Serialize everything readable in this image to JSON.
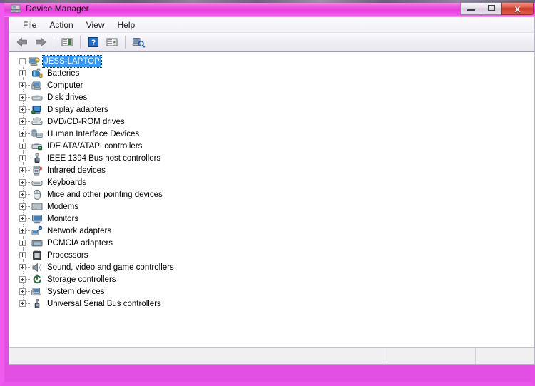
{
  "window": {
    "title": "Device Manager",
    "title_icon": "device-manager-icon",
    "buttons": {
      "minimize": "–",
      "maximize": "□",
      "close": "x"
    }
  },
  "menubar": {
    "items": [
      {
        "label": "File",
        "name": "menu-file"
      },
      {
        "label": "Action",
        "name": "menu-action"
      },
      {
        "label": "View",
        "name": "menu-view"
      },
      {
        "label": "Help",
        "name": "menu-help"
      }
    ]
  },
  "toolbar": {
    "items": [
      {
        "name": "back-arrow-icon",
        "tooltip": "Back"
      },
      {
        "name": "forward-arrow-icon",
        "tooltip": "Forward"
      },
      {
        "name": "separator-1"
      },
      {
        "name": "properties-icon",
        "tooltip": "Properties"
      },
      {
        "name": "separator-2"
      },
      {
        "name": "help-icon",
        "tooltip": "Help"
      },
      {
        "name": "update-driver-icon",
        "tooltip": "Update Driver Software"
      },
      {
        "name": "separator-3"
      },
      {
        "name": "scan-hardware-icon",
        "tooltip": "Scan for hardware changes"
      }
    ]
  },
  "tree": {
    "root": {
      "label": "JESS-LAPTOP",
      "icon": "computer-root-icon",
      "expanded": true,
      "selected": true
    },
    "children": [
      {
        "label": "Batteries",
        "icon": "battery-icon"
      },
      {
        "label": "Computer",
        "icon": "computer-icon"
      },
      {
        "label": "Disk drives",
        "icon": "disk-drive-icon"
      },
      {
        "label": "Display adapters",
        "icon": "display-adapter-icon"
      },
      {
        "label": "DVD/CD-ROM drives",
        "icon": "dvd-drive-icon"
      },
      {
        "label": "Human Interface Devices",
        "icon": "hid-icon"
      },
      {
        "label": "IDE ATA/ATAPI controllers",
        "icon": "ide-controller-icon"
      },
      {
        "label": "IEEE 1394 Bus host controllers",
        "icon": "ieee1394-icon"
      },
      {
        "label": "Infrared devices",
        "icon": "infrared-icon"
      },
      {
        "label": "Keyboards",
        "icon": "keyboard-icon"
      },
      {
        "label": "Mice and other pointing devices",
        "icon": "mouse-icon"
      },
      {
        "label": "Modems",
        "icon": "modem-icon"
      },
      {
        "label": "Monitors",
        "icon": "monitor-icon"
      },
      {
        "label": "Network adapters",
        "icon": "network-adapter-icon"
      },
      {
        "label": "PCMCIA adapters",
        "icon": "pcmcia-icon"
      },
      {
        "label": "Processors",
        "icon": "processor-icon"
      },
      {
        "label": "Sound, video and game controllers",
        "icon": "sound-icon"
      },
      {
        "label": "Storage controllers",
        "icon": "storage-controller-icon"
      },
      {
        "label": "System devices",
        "icon": "system-device-icon"
      },
      {
        "label": "Universal Serial Bus controllers",
        "icon": "usb-icon"
      }
    ]
  },
  "statusbar": {
    "panes": [
      "",
      "",
      ""
    ]
  },
  "colors": {
    "titlebar_accent": "#ee4fe0",
    "frame": "#e24fe2",
    "selection": "#3399ff",
    "close_button": "#cc3b2a"
  }
}
